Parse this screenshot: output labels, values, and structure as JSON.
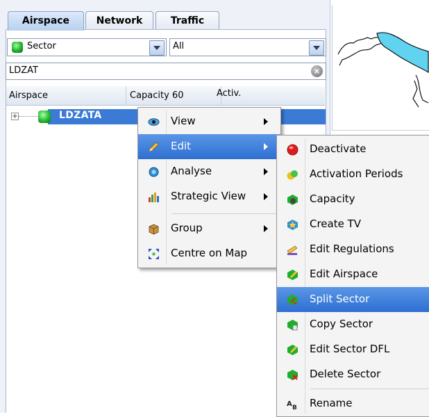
{
  "tabs": [
    {
      "label": "Airspace",
      "active": true
    },
    {
      "label": "Network",
      "active": false
    },
    {
      "label": "Traffic",
      "active": false
    }
  ],
  "filter": {
    "type_value": "Sector",
    "scope_value": "All"
  },
  "search": {
    "value": "LDZAT",
    "clear_icon": "clear-icon"
  },
  "columns": [
    "Airspace",
    "Capacity 60",
    "Activ."
  ],
  "tree": {
    "row_label": "LDZATA",
    "expander": "+"
  },
  "context_menu": {
    "items": [
      {
        "label": "View",
        "icon": "eye-icon",
        "submenu": true
      },
      {
        "label": "Edit",
        "icon": "pencil-icon",
        "submenu": true,
        "highlighted": true
      },
      {
        "label": "Analyse",
        "icon": "analyse-icon",
        "submenu": true
      },
      {
        "label": "Strategic View",
        "icon": "bar-chart-icon",
        "submenu": true
      },
      {
        "label": "Group",
        "icon": "package-icon",
        "submenu": true
      },
      {
        "label": "Centre on Map",
        "icon": "centre-arrows-icon",
        "submenu": false
      }
    ]
  },
  "edit_submenu": {
    "items": [
      {
        "label": "Deactivate",
        "icon": "red-dot-icon"
      },
      {
        "label": "Activation Periods",
        "icon": "activation-periods-icon"
      },
      {
        "label": "Capacity",
        "icon": "capacity-icon"
      },
      {
        "label": "Create TV",
        "icon": "create-tv-icon"
      },
      {
        "label": "Edit Regulations",
        "icon": "edit-regulations-icon"
      },
      {
        "label": "Edit Airspace",
        "icon": "edit-airspace-icon"
      },
      {
        "label": "Split Sector",
        "icon": "split-sector-icon",
        "highlighted": true
      },
      {
        "label": "Copy Sector",
        "icon": "copy-sector-icon"
      },
      {
        "label": "Edit Sector DFL",
        "icon": "edit-sector-dfl-icon"
      },
      {
        "label": "Delete Sector",
        "icon": "delete-sector-icon"
      },
      {
        "label": "Rename",
        "icon": "rename-icon"
      }
    ]
  },
  "colors": {
    "selection": "#3b7bd6",
    "menu_highlight": "#2d6fd2",
    "sector_green": "#1fae2a",
    "map_water": "#5fd3f0"
  }
}
